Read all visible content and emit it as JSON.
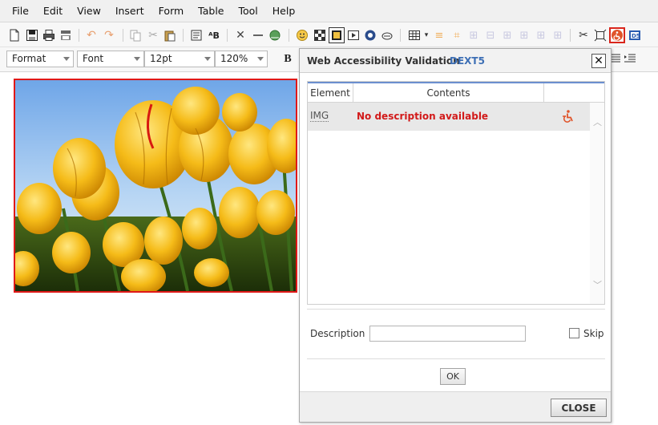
{
  "menubar": {
    "items": [
      "File",
      "Edit",
      "View",
      "Insert",
      "Form",
      "Table",
      "Tool",
      "Help"
    ]
  },
  "toolbar": {
    "icons": [
      "new-document-icon",
      "save-icon",
      "print-icon",
      "print-preview-icon",
      "undo-icon",
      "redo-icon",
      "copy-icon",
      "cut-icon",
      "paste-icon",
      "paste-text-icon",
      "spell-check-icon",
      "special-char-icon",
      "horizontal-line-icon",
      "link-icon",
      "emoticon-icon",
      "background-icon",
      "image-icon",
      "media-icon",
      "flash-icon",
      "bookmark-icon",
      "table-icon",
      "table-props-icon",
      "cell-props-icon",
      "merge-cells-icon",
      "split-cells-icon",
      "insert-row-icon",
      "insert-col-icon",
      "delete-row-icon",
      "delete-col-icon",
      "tools-icon",
      "fullscreen-icon",
      "accessibility-icon",
      "dext5-icon"
    ]
  },
  "formatbar": {
    "format": "Format",
    "font": "Font",
    "size": "12pt",
    "zoom": "120%",
    "bold": "B"
  },
  "dialog": {
    "title": "Web Accessibility Validation",
    "brand": "DEXT5",
    "columns": [
      "Element",
      "Contents"
    ],
    "rows": [
      {
        "element": "IMG",
        "contents": "No description available"
      }
    ],
    "description_label": "Description",
    "description_value": "",
    "skip_label": "Skip",
    "ok_label": "OK",
    "close_label": "CLOSE"
  },
  "colors": {
    "error_text": "#d21a1a",
    "brand_blue": "#3d6fb5",
    "selection_border": "#e01818",
    "grid_header_line": "#6b8fcf"
  }
}
